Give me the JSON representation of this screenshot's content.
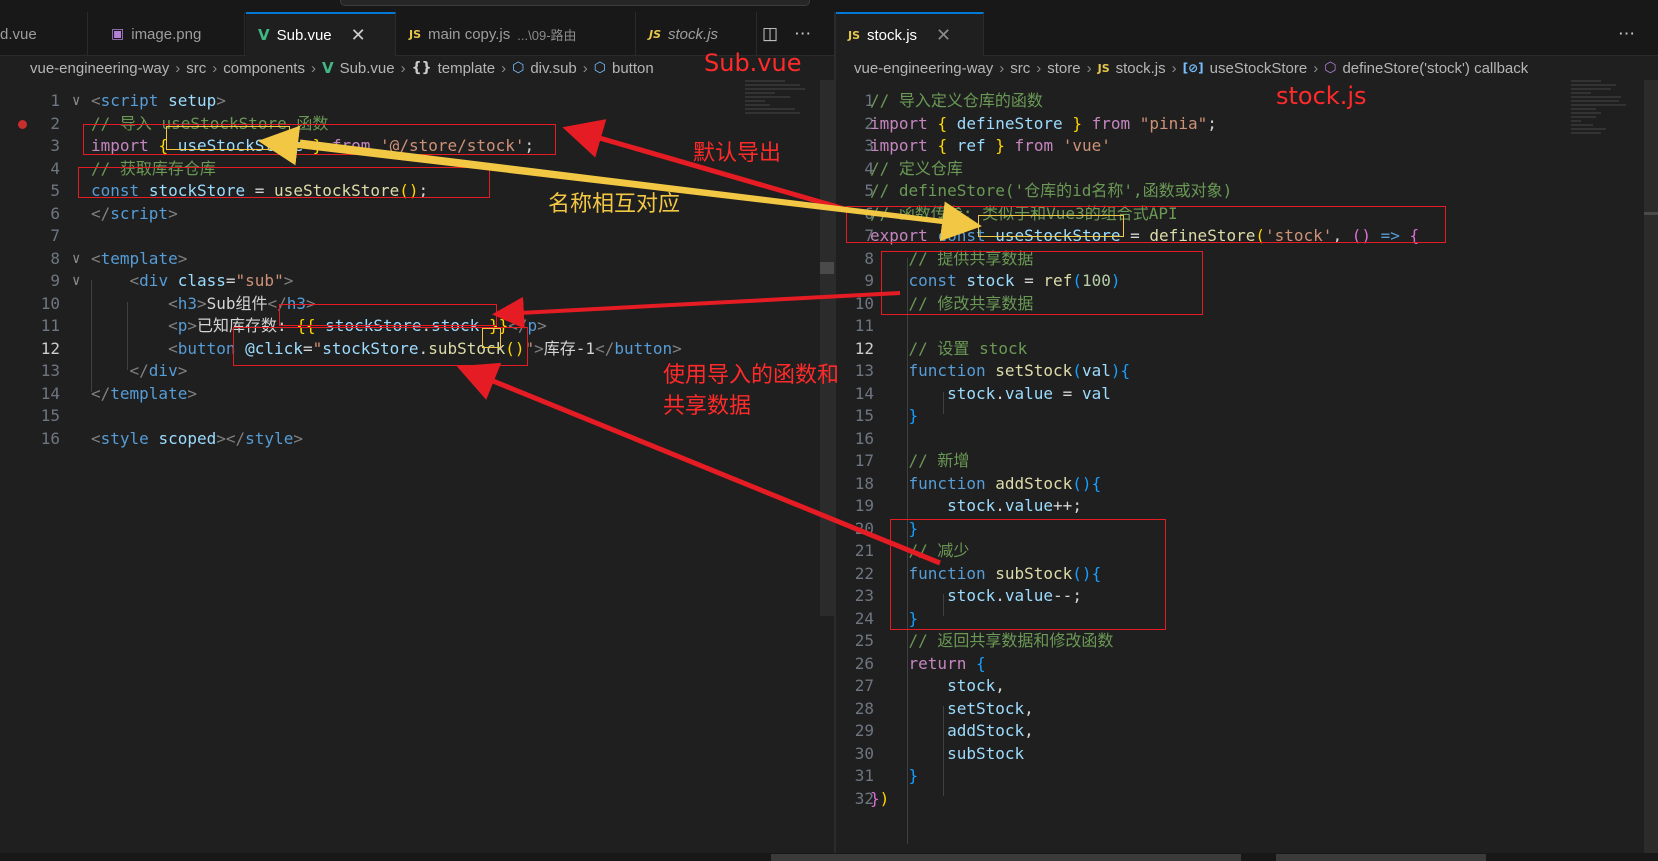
{
  "left": {
    "tabs": [
      {
        "label": "d.vue",
        "icon": "vue-icon"
      },
      {
        "label": "image.png",
        "icon": "image-icon"
      },
      {
        "label": "Sub.vue",
        "icon": "vue-icon",
        "active": true
      },
      {
        "label": "main copy.js",
        "desc": "...\\09-路由",
        "icon": "js-icon"
      },
      {
        "label": "stock.js",
        "icon": "js-icon"
      }
    ],
    "breadcrumb": [
      "vue-engineering-way",
      "src",
      "components",
      "Sub.vue",
      "template",
      "div.sub",
      "button"
    ],
    "lines": [
      {
        "n": "1",
        "fold": "∨",
        "parts": [
          [
            "t",
            "<"
          ],
          [
            "tg",
            "script"
          ],
          [
            "w",
            " "
          ],
          [
            "at",
            "setup"
          ],
          [
            "t",
            ">"
          ]
        ]
      },
      {
        "n": "2",
        "fold": "",
        "parts": [
          [
            "c",
            "// 导入 useStockStore 函数"
          ]
        ]
      },
      {
        "n": "3",
        "fold": "",
        "parts": [
          [
            "kc",
            "import"
          ],
          [
            "w",
            " "
          ],
          [
            "p1",
            "{"
          ],
          [
            "w",
            " "
          ],
          [
            "v",
            "useStockStore"
          ],
          [
            "w",
            " "
          ],
          [
            "p1",
            "}"
          ],
          [
            "w",
            " "
          ],
          [
            "kc",
            "from"
          ],
          [
            "w",
            " "
          ],
          [
            "s",
            "'@/store/stock'"
          ],
          [
            "w",
            ";"
          ]
        ]
      },
      {
        "n": "4",
        "fold": "",
        "parts": [
          [
            "c",
            "// 获取库存仓库"
          ]
        ]
      },
      {
        "n": "5",
        "fold": "",
        "parts": [
          [
            "k",
            "const"
          ],
          [
            "w",
            " "
          ],
          [
            "v",
            "stockStore"
          ],
          [
            "w",
            " = "
          ],
          [
            "f",
            "useStockStore"
          ],
          [
            "p1",
            "()"
          ],
          [
            "w",
            ";"
          ]
        ]
      },
      {
        "n": "6",
        "fold": "",
        "parts": [
          [
            "t",
            "</"
          ],
          [
            "tg",
            "script"
          ],
          [
            "t",
            ">"
          ]
        ]
      },
      {
        "n": "7",
        "fold": "",
        "parts": []
      },
      {
        "n": "8",
        "fold": "∨",
        "parts": [
          [
            "t",
            "<"
          ],
          [
            "tg",
            "template"
          ],
          [
            "t",
            ">"
          ]
        ]
      },
      {
        "n": "9",
        "fold": "∨",
        "parts": [
          [
            "w",
            "    "
          ],
          [
            "t",
            "<"
          ],
          [
            "tg",
            "div"
          ],
          [
            "w",
            " "
          ],
          [
            "at",
            "class"
          ],
          [
            "w",
            "="
          ],
          [
            "s",
            "\"sub\""
          ],
          [
            "t",
            ">"
          ]
        ]
      },
      {
        "n": "10",
        "fold": "",
        "parts": [
          [
            "w",
            "        "
          ],
          [
            "t",
            "<"
          ],
          [
            "tg",
            "h3"
          ],
          [
            "t",
            ">"
          ],
          [
            "w",
            "Sub组件"
          ],
          [
            "t",
            "</"
          ],
          [
            "tg",
            "h3"
          ],
          [
            "t",
            ">"
          ]
        ]
      },
      {
        "n": "11",
        "fold": "",
        "parts": [
          [
            "w",
            "        "
          ],
          [
            "t",
            "<"
          ],
          [
            "tg",
            "p"
          ],
          [
            "t",
            ">"
          ],
          [
            "w",
            "已知库存数: "
          ],
          [
            "p1",
            "{{"
          ],
          [
            "w",
            " "
          ],
          [
            "v",
            "stockStore"
          ],
          [
            "w",
            "."
          ],
          [
            "v",
            "stock"
          ],
          [
            "w",
            " "
          ],
          [
            "p1",
            "}}"
          ],
          [
            "t",
            "</"
          ],
          [
            "tg",
            "p"
          ],
          [
            "t",
            ">"
          ]
        ]
      },
      {
        "n": "12",
        "fold": "",
        "cur": true,
        "parts": [
          [
            "w",
            "        "
          ],
          [
            "t",
            "<"
          ],
          [
            "tg",
            "button"
          ],
          [
            "w",
            " "
          ],
          [
            "at",
            "@click"
          ],
          [
            "w",
            "="
          ],
          [
            "s",
            "\""
          ],
          [
            "v",
            "stockStore"
          ],
          [
            "w",
            "."
          ],
          [
            "f",
            "subStock"
          ],
          [
            "p1",
            "()"
          ],
          [
            "s",
            "\""
          ],
          [
            "t",
            ">"
          ],
          [
            "w",
            "库存-1"
          ],
          [
            "t",
            "</"
          ],
          [
            "tg",
            "button"
          ],
          [
            "t",
            ">"
          ]
        ]
      },
      {
        "n": "13",
        "fold": "",
        "parts": [
          [
            "w",
            "    "
          ],
          [
            "t",
            "</"
          ],
          [
            "tg",
            "div"
          ],
          [
            "t",
            ">"
          ]
        ]
      },
      {
        "n": "14",
        "fold": "",
        "parts": [
          [
            "t",
            "</"
          ],
          [
            "tg",
            "template"
          ],
          [
            "t",
            ">"
          ]
        ]
      },
      {
        "n": "15",
        "fold": "",
        "parts": []
      },
      {
        "n": "16",
        "fold": "",
        "parts": [
          [
            "t",
            "<"
          ],
          [
            "tg",
            "style"
          ],
          [
            "w",
            " "
          ],
          [
            "at",
            "scoped"
          ],
          [
            "t",
            "></"
          ],
          [
            "tg",
            "style"
          ],
          [
            "t",
            ">"
          ]
        ]
      }
    ]
  },
  "right": {
    "tabs": [
      {
        "label": "stock.js",
        "icon": "js-icon"
      }
    ],
    "breadcrumb": [
      "vue-engineering-way",
      "src",
      "store",
      "stock.js",
      "useStockStore",
      "defineStore('stock') callback"
    ],
    "lines": [
      {
        "n": "1",
        "parts": [
          [
            "c",
            "// 导入定义仓库的函数"
          ]
        ]
      },
      {
        "n": "2",
        "parts": [
          [
            "kc",
            "import"
          ],
          [
            "w",
            " "
          ],
          [
            "p1",
            "{"
          ],
          [
            "w",
            " "
          ],
          [
            "v",
            "defineStore"
          ],
          [
            "w",
            " "
          ],
          [
            "p1",
            "}"
          ],
          [
            "w",
            " "
          ],
          [
            "kc",
            "from"
          ],
          [
            "w",
            " "
          ],
          [
            "s",
            "\"pinia\""
          ],
          [
            "w",
            ";"
          ]
        ]
      },
      {
        "n": "3",
        "parts": [
          [
            "kc",
            "import"
          ],
          [
            "w",
            " "
          ],
          [
            "p1",
            "{"
          ],
          [
            "w",
            " "
          ],
          [
            "v",
            "ref"
          ],
          [
            "w",
            " "
          ],
          [
            "p1",
            "}"
          ],
          [
            "w",
            " "
          ],
          [
            "kc",
            "from"
          ],
          [
            "w",
            " "
          ],
          [
            "s",
            "'vue'"
          ]
        ]
      },
      {
        "n": "4",
        "parts": [
          [
            "c",
            "// 定义仓库"
          ]
        ]
      },
      {
        "n": "5",
        "parts": [
          [
            "c",
            "// defineStore('仓库的id名称',函数或对象)"
          ]
        ]
      },
      {
        "n": "6",
        "parts": [
          [
            "c",
            "// 函数传参: 类似于和Vue3的组合式API"
          ]
        ]
      },
      {
        "n": "7",
        "parts": [
          [
            "kc",
            "export"
          ],
          [
            "w",
            " "
          ],
          [
            "k",
            "const"
          ],
          [
            "w",
            " "
          ],
          [
            "v",
            "useStockStore"
          ],
          [
            "w",
            " = "
          ],
          [
            "f",
            "defineStore"
          ],
          [
            "p1",
            "("
          ],
          [
            "s",
            "'stock'"
          ],
          [
            "w",
            ", "
          ],
          [
            "p2",
            "()"
          ],
          [
            "w",
            " "
          ],
          [
            "k",
            "=>"
          ],
          [
            "w",
            " "
          ],
          [
            "p2",
            "{"
          ]
        ]
      },
      {
        "n": "8",
        "parts": [
          [
            "w",
            "    "
          ],
          [
            "c",
            "// 提供共享数据"
          ]
        ]
      },
      {
        "n": "9",
        "parts": [
          [
            "w",
            "    "
          ],
          [
            "k",
            "const"
          ],
          [
            "w",
            " "
          ],
          [
            "v",
            "stock"
          ],
          [
            "w",
            " = "
          ],
          [
            "f",
            "ref"
          ],
          [
            "p3",
            "("
          ],
          [
            "n",
            "100"
          ],
          [
            "p3",
            ")"
          ]
        ]
      },
      {
        "n": "10",
        "parts": [
          [
            "w",
            "    "
          ],
          [
            "c",
            "// 修改共享数据"
          ]
        ]
      },
      {
        "n": "11",
        "parts": []
      },
      {
        "n": "12",
        "cur": true,
        "parts": [
          [
            "w",
            "    "
          ],
          [
            "c",
            "// 设置 stock"
          ]
        ]
      },
      {
        "n": "13",
        "parts": [
          [
            "w",
            "    "
          ],
          [
            "k",
            "function"
          ],
          [
            "w",
            " "
          ],
          [
            "f",
            "setStock"
          ],
          [
            "p3",
            "("
          ],
          [
            "v",
            "val"
          ],
          [
            "p3",
            ")"
          ],
          [
            "p3",
            "{"
          ]
        ]
      },
      {
        "n": "14",
        "parts": [
          [
            "w",
            "        "
          ],
          [
            "v",
            "stock"
          ],
          [
            "w",
            "."
          ],
          [
            "v",
            "value"
          ],
          [
            "w",
            " = "
          ],
          [
            "v",
            "val"
          ]
        ]
      },
      {
        "n": "15",
        "parts": [
          [
            "w",
            "    "
          ],
          [
            "p3",
            "}"
          ]
        ]
      },
      {
        "n": "16",
        "parts": []
      },
      {
        "n": "17",
        "parts": [
          [
            "w",
            "    "
          ],
          [
            "c",
            "// 新增"
          ]
        ]
      },
      {
        "n": "18",
        "parts": [
          [
            "w",
            "    "
          ],
          [
            "k",
            "function"
          ],
          [
            "w",
            " "
          ],
          [
            "f",
            "addStock"
          ],
          [
            "p3",
            "()"
          ],
          [
            "p3",
            "{"
          ]
        ]
      },
      {
        "n": "19",
        "parts": [
          [
            "w",
            "        "
          ],
          [
            "v",
            "stock"
          ],
          [
            "w",
            "."
          ],
          [
            "v",
            "value"
          ],
          [
            "w",
            "++;"
          ]
        ]
      },
      {
        "n": "20",
        "parts": [
          [
            "w",
            "    "
          ],
          [
            "p3",
            "}"
          ]
        ]
      },
      {
        "n": "21",
        "parts": [
          [
            "w",
            "    "
          ],
          [
            "c",
            "// 减少"
          ]
        ]
      },
      {
        "n": "22",
        "parts": [
          [
            "w",
            "    "
          ],
          [
            "k",
            "function"
          ],
          [
            "w",
            " "
          ],
          [
            "f",
            "subStock"
          ],
          [
            "p3",
            "()"
          ],
          [
            "p3",
            "{"
          ]
        ]
      },
      {
        "n": "23",
        "parts": [
          [
            "w",
            "        "
          ],
          [
            "v",
            "stock"
          ],
          [
            "w",
            "."
          ],
          [
            "v",
            "value"
          ],
          [
            "w",
            "--;"
          ]
        ]
      },
      {
        "n": "24",
        "parts": [
          [
            "w",
            "    "
          ],
          [
            "p3",
            "}"
          ]
        ]
      },
      {
        "n": "25",
        "parts": [
          [
            "w",
            "    "
          ],
          [
            "c",
            "// 返回共享数据和修改函数"
          ]
        ]
      },
      {
        "n": "26",
        "parts": [
          [
            "w",
            "    "
          ],
          [
            "kc",
            "return"
          ],
          [
            "w",
            " "
          ],
          [
            "p3",
            "{"
          ]
        ]
      },
      {
        "n": "27",
        "parts": [
          [
            "w",
            "        "
          ],
          [
            "v",
            "stock"
          ],
          [
            "w",
            ","
          ]
        ]
      },
      {
        "n": "28",
        "parts": [
          [
            "w",
            "        "
          ],
          [
            "v",
            "setStock"
          ],
          [
            "w",
            ","
          ]
        ]
      },
      {
        "n": "29",
        "parts": [
          [
            "w",
            "        "
          ],
          [
            "v",
            "addStock"
          ],
          [
            "w",
            ","
          ]
        ]
      },
      {
        "n": "30",
        "parts": [
          [
            "w",
            "        "
          ],
          [
            "v",
            "subStock"
          ]
        ]
      },
      {
        "n": "31",
        "parts": [
          [
            "w",
            "    "
          ],
          [
            "p3",
            "}"
          ]
        ]
      },
      {
        "n": "32",
        "parts": [
          [
            "p2",
            "}"
          ],
          [
            "p1",
            ")"
          ]
        ]
      }
    ]
  },
  "annotations": {
    "sub_vue": "Sub.vue",
    "stock_js": "stock.js",
    "default_export": "默认导出",
    "names_match": "名称相互对应",
    "use_imported": "使用导入的函数和",
    "shared_data": "共享数据"
  },
  "colors": {
    "bg": "#1f1f1f",
    "annotation_red": "#e51c23",
    "annotation_yellow": "#f2c744",
    "accent": "#0078d4"
  }
}
